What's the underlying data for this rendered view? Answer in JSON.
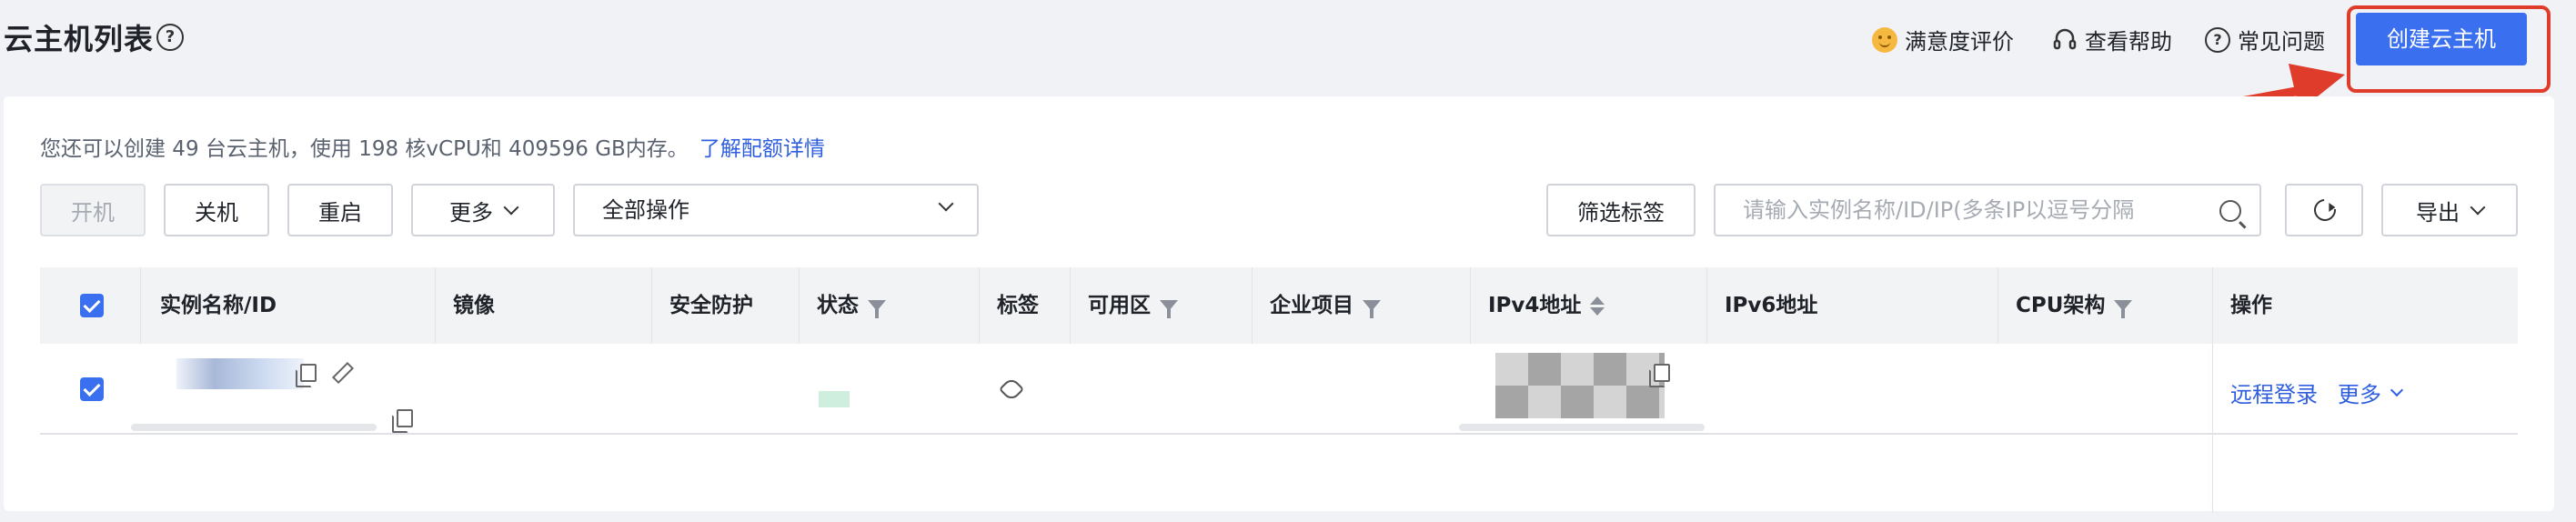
{
  "header": {
    "title": "云主机列表",
    "help_icon_glyph": "?",
    "links": [
      {
        "label": "满意度评价",
        "icon": "smile-icon"
      },
      {
        "label": "查看帮助",
        "icon": "headset-icon"
      },
      {
        "label": "常见问题",
        "icon": "question-circle-icon"
      }
    ],
    "create_button": "创建云主机"
  },
  "toolbar": {
    "quota_text": "您还可以创建 49 台云主机，使用 198 核vCPU和 409596 GB内存。",
    "quota_link": "了解配额详情",
    "buttons": {
      "power_on": "开机",
      "power_off": "关机",
      "restart": "重启",
      "more": "更多"
    },
    "bulk_select": "全部操作",
    "filter_tags": "筛选标签",
    "search_placeholder": "请输入实例名称/ID/IP(多条IP以逗号分隔",
    "export": "导出"
  },
  "table": {
    "columns": [
      {
        "label": "实例名称/ID"
      },
      {
        "label": "镜像"
      },
      {
        "label": "安全防护"
      },
      {
        "label": "状态",
        "filter": true
      },
      {
        "label": "标签"
      },
      {
        "label": "可用区",
        "filter": true
      },
      {
        "label": "企业项目",
        "filter": true
      },
      {
        "label": "IPv4地址",
        "sort": true
      },
      {
        "label": "IPv6地址"
      },
      {
        "label": "CPU架构",
        "filter": true
      },
      {
        "label": "操作"
      }
    ],
    "rows": [
      {
        "checked": true,
        "ops": {
          "remote_login": "远程登录",
          "more": "更多"
        }
      }
    ]
  },
  "colors": {
    "primary": "#3a6ff0",
    "highlight": "#e03c2b",
    "link": "#2f5fe0"
  }
}
